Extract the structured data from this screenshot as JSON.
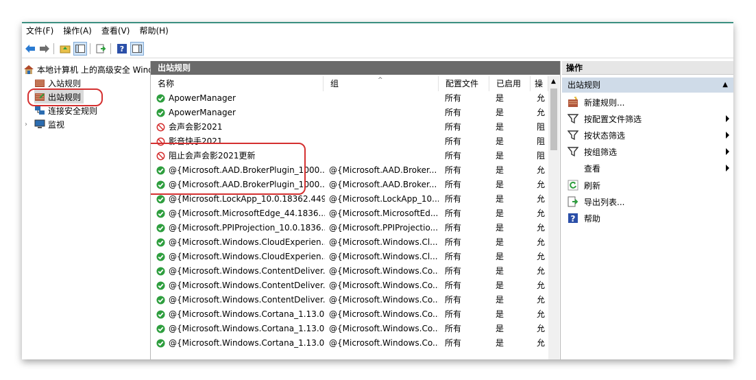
{
  "menu": [
    "文件(F)",
    "操作(A)",
    "查看(V)",
    "帮助(H)"
  ],
  "tree": {
    "root": "本地计算机 上的高级安全 Windows Defender 防火墙",
    "items": [
      "入站规则",
      "出站规则",
      "连接安全规则",
      "监视"
    ]
  },
  "center": {
    "title": "出站规则",
    "columns": [
      "名称",
      "组",
      "配置文件",
      "已启用",
      "操"
    ],
    "rows": [
      {
        "name": "ApowerManager",
        "group": "",
        "profile": "所有",
        "enabled": "是",
        "action": "允",
        "status": "allow"
      },
      {
        "name": "ApowerManager",
        "group": "",
        "profile": "所有",
        "enabled": "是",
        "action": "允",
        "status": "allow"
      },
      {
        "name": "会声会影2021",
        "group": "",
        "profile": "所有",
        "enabled": "是",
        "action": "阻",
        "status": "block"
      },
      {
        "name": "影音快手2021",
        "group": "",
        "profile": "所有",
        "enabled": "是",
        "action": "阻",
        "status": "block"
      },
      {
        "name": "阻止会声会影2021更新",
        "group": "",
        "profile": "所有",
        "enabled": "是",
        "action": "阻",
        "status": "block"
      },
      {
        "name": "@{Microsoft.AAD.BrokerPlugin_1000....",
        "group": "@{Microsoft.AAD.Broker...",
        "profile": "所有",
        "enabled": "是",
        "action": "允",
        "status": "allow"
      },
      {
        "name": "@{Microsoft.AAD.BrokerPlugin_1000....",
        "group": "@{Microsoft.AAD.Broker...",
        "profile": "所有",
        "enabled": "是",
        "action": "允",
        "status": "allow"
      },
      {
        "name": "@{Microsoft.LockApp_10.0.18362.449...",
        "group": "@{Microsoft.LockApp_10....",
        "profile": "所有",
        "enabled": "是",
        "action": "允",
        "status": "allow"
      },
      {
        "name": "@{Microsoft.MicrosoftEdge_44.1836...",
        "group": "@{Microsoft.MicrosoftEd...",
        "profile": "所有",
        "enabled": "是",
        "action": "允",
        "status": "allow"
      },
      {
        "name": "@{Microsoft.PPIProjection_10.0.1836...",
        "group": "@{Microsoft.PPIProjectio...",
        "profile": "所有",
        "enabled": "是",
        "action": "允",
        "status": "allow"
      },
      {
        "name": "@{Microsoft.Windows.CloudExperien...",
        "group": "@{Microsoft.Windows.Cl...",
        "profile": "所有",
        "enabled": "是",
        "action": "允",
        "status": "allow"
      },
      {
        "name": "@{Microsoft.Windows.CloudExperien...",
        "group": "@{Microsoft.Windows.Cl...",
        "profile": "所有",
        "enabled": "是",
        "action": "允",
        "status": "allow"
      },
      {
        "name": "@{Microsoft.Windows.ContentDeliver...",
        "group": "@{Microsoft.Windows.Co...",
        "profile": "所有",
        "enabled": "是",
        "action": "允",
        "status": "allow"
      },
      {
        "name": "@{Microsoft.Windows.ContentDeliver...",
        "group": "@{Microsoft.Windows.Co...",
        "profile": "所有",
        "enabled": "是",
        "action": "允",
        "status": "allow"
      },
      {
        "name": "@{Microsoft.Windows.ContentDeliver...",
        "group": "@{Microsoft.Windows.Co...",
        "profile": "所有",
        "enabled": "是",
        "action": "允",
        "status": "allow"
      },
      {
        "name": "@{Microsoft.Windows.Cortana_1.13.0....",
        "group": "@{Microsoft.Windows.Co...",
        "profile": "所有",
        "enabled": "是",
        "action": "允",
        "status": "allow"
      },
      {
        "name": "@{Microsoft.Windows.Cortana_1.13.0....",
        "group": "@{Microsoft.Windows.Co...",
        "profile": "所有",
        "enabled": "是",
        "action": "允",
        "status": "allow"
      },
      {
        "name": "@{Microsoft.Windows.Cortana_1.13.0....",
        "group": "@{Microsoft.Windows.Co...",
        "profile": "所有",
        "enabled": "是",
        "action": "允",
        "status": "allow"
      }
    ]
  },
  "actions": {
    "title": "操作",
    "section": "出站规则",
    "items": [
      "新建规则...",
      "按配置文件筛选",
      "按状态筛选",
      "按组筛选",
      "查看",
      "刷新",
      "导出列表...",
      "帮助"
    ]
  },
  "colors": {
    "allow": "#2e9e3e",
    "block": "#d42f2f",
    "highlight": "#d42f2f",
    "accent": "#3a8f80"
  }
}
